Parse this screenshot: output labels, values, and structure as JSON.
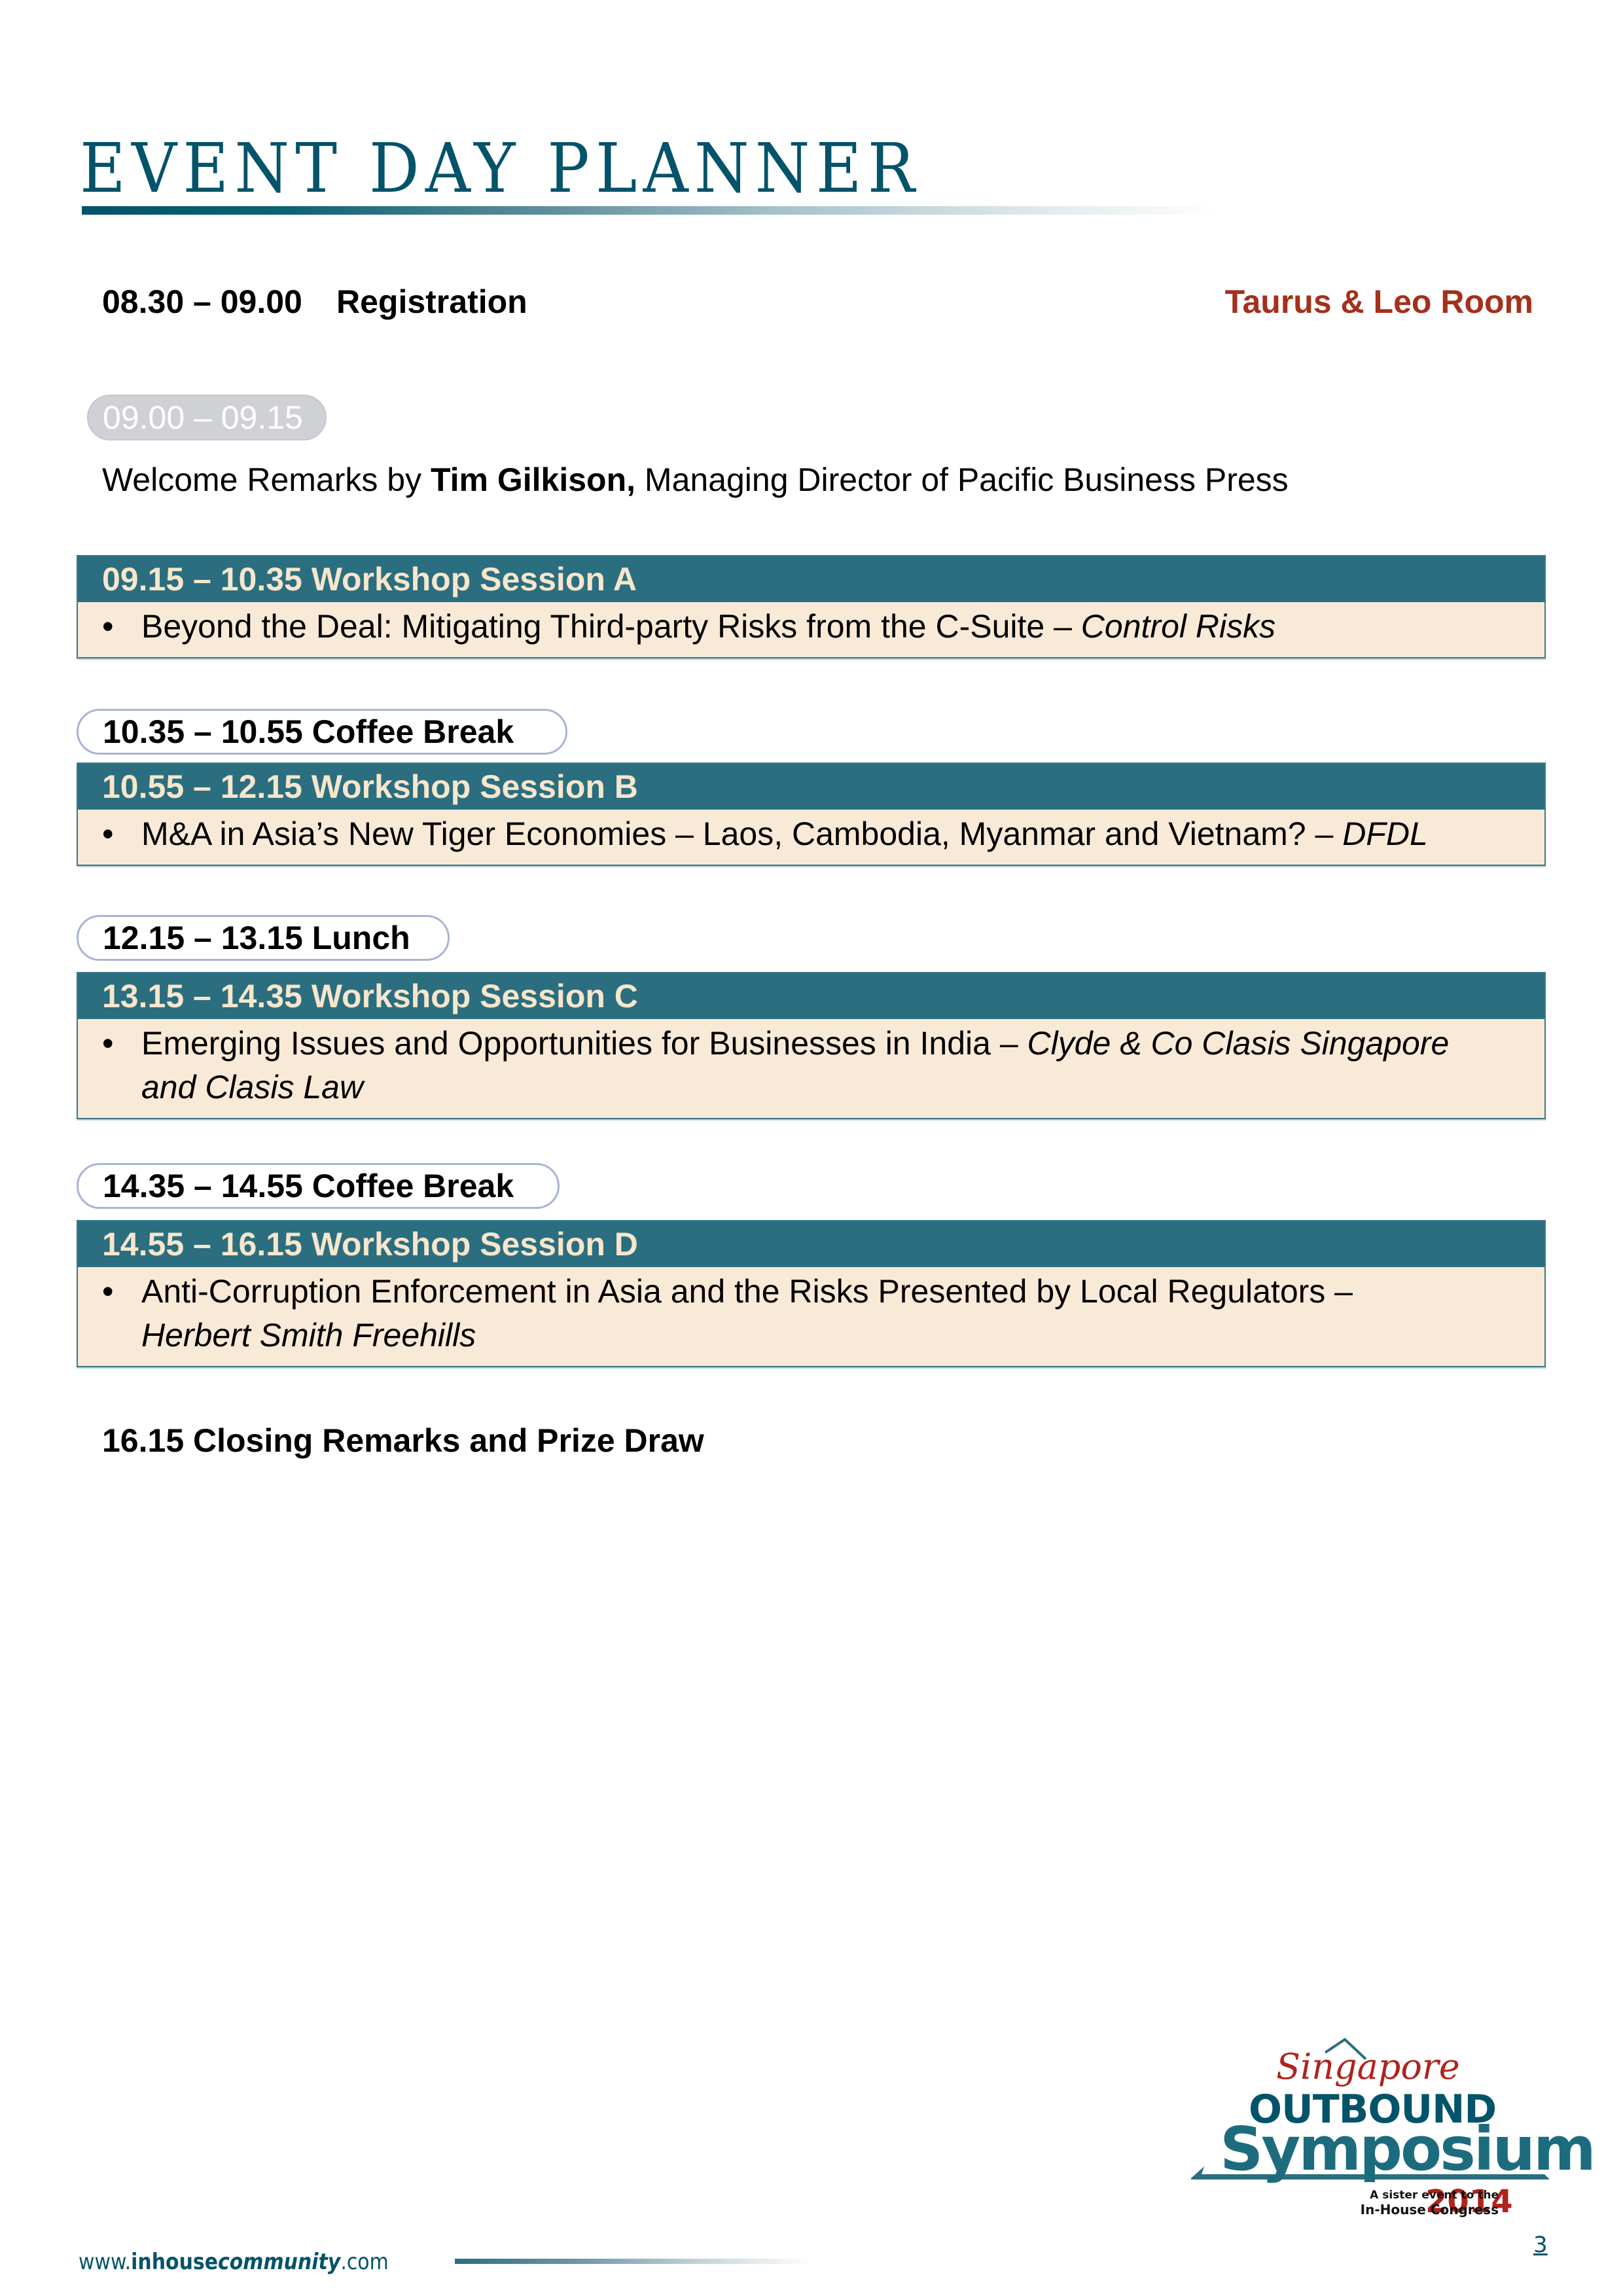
{
  "title": "EVENT DAY PLANNER",
  "registration": {
    "time": "08.30 – 09.00",
    "label": "Registration",
    "room": "Taurus & Leo Room"
  },
  "welcome": {
    "time": "09.00 – 09.15",
    "prefix": "Welcome Remarks by ",
    "speaker": "Tim Gilkison,",
    "suffix": " Managing Director of Pacific Business Press"
  },
  "sessions": [
    {
      "heading": "09.15 – 10.35  Workshop Session A",
      "bullet": "•",
      "topic": "Beyond the Deal: Mitigating Third-party Risks from the C-Suite – ",
      "presenter": "Control Risks"
    },
    {
      "heading": "10.55 – 12.15  Workshop Session B",
      "bullet": "•",
      "topic": "M&A in Asia’s New Tiger Economies – Laos, Cambodia, Myanmar and Vietnam? – ",
      "presenter": "DFDL"
    },
    {
      "heading": "13.15 – 14.35  Workshop Session C",
      "bullet": "•",
      "topic": "Emerging Issues and Opportunities for Businesses in India – ",
      "presenter": "Clyde & Co Clasis Singapore and Clasis Law"
    },
    {
      "heading": "14.55 – 16.15  Workshop Session D",
      "bullet": "•",
      "topic": "Anti-Corruption Enforcement in Asia and the Risks Presented by Local Regulators – ",
      "presenter": "Herbert Smith Freehills"
    }
  ],
  "breaks": [
    {
      "label": "10.35 – 10.55  Coffee Break"
    },
    {
      "label": "12.15 – 13.15  Lunch"
    },
    {
      "label": "14.35 – 14.55  Coffee Break"
    }
  ],
  "closing": "16.15  Closing Remarks and Prize Draw",
  "logo": {
    "line1": "Singapore",
    "line2": "OUTBOUND",
    "line3": "Symposium",
    "year": "2014",
    "tagline1": "A sister event to the",
    "tagline2": "In-House Congress"
  },
  "footer": {
    "url_prefix": "www.",
    "url_bold": "inhouse",
    "url_italic": "community",
    "url_suffix": ".com",
    "page_number": "3"
  },
  "colors": {
    "brand_teal": "#03536a",
    "session_header": "#2b6e7f",
    "session_header_text": "#f6e6cc",
    "session_body": "#f9ead7",
    "room_red": "#a5301c",
    "pill_border": "#a8b4d6"
  }
}
